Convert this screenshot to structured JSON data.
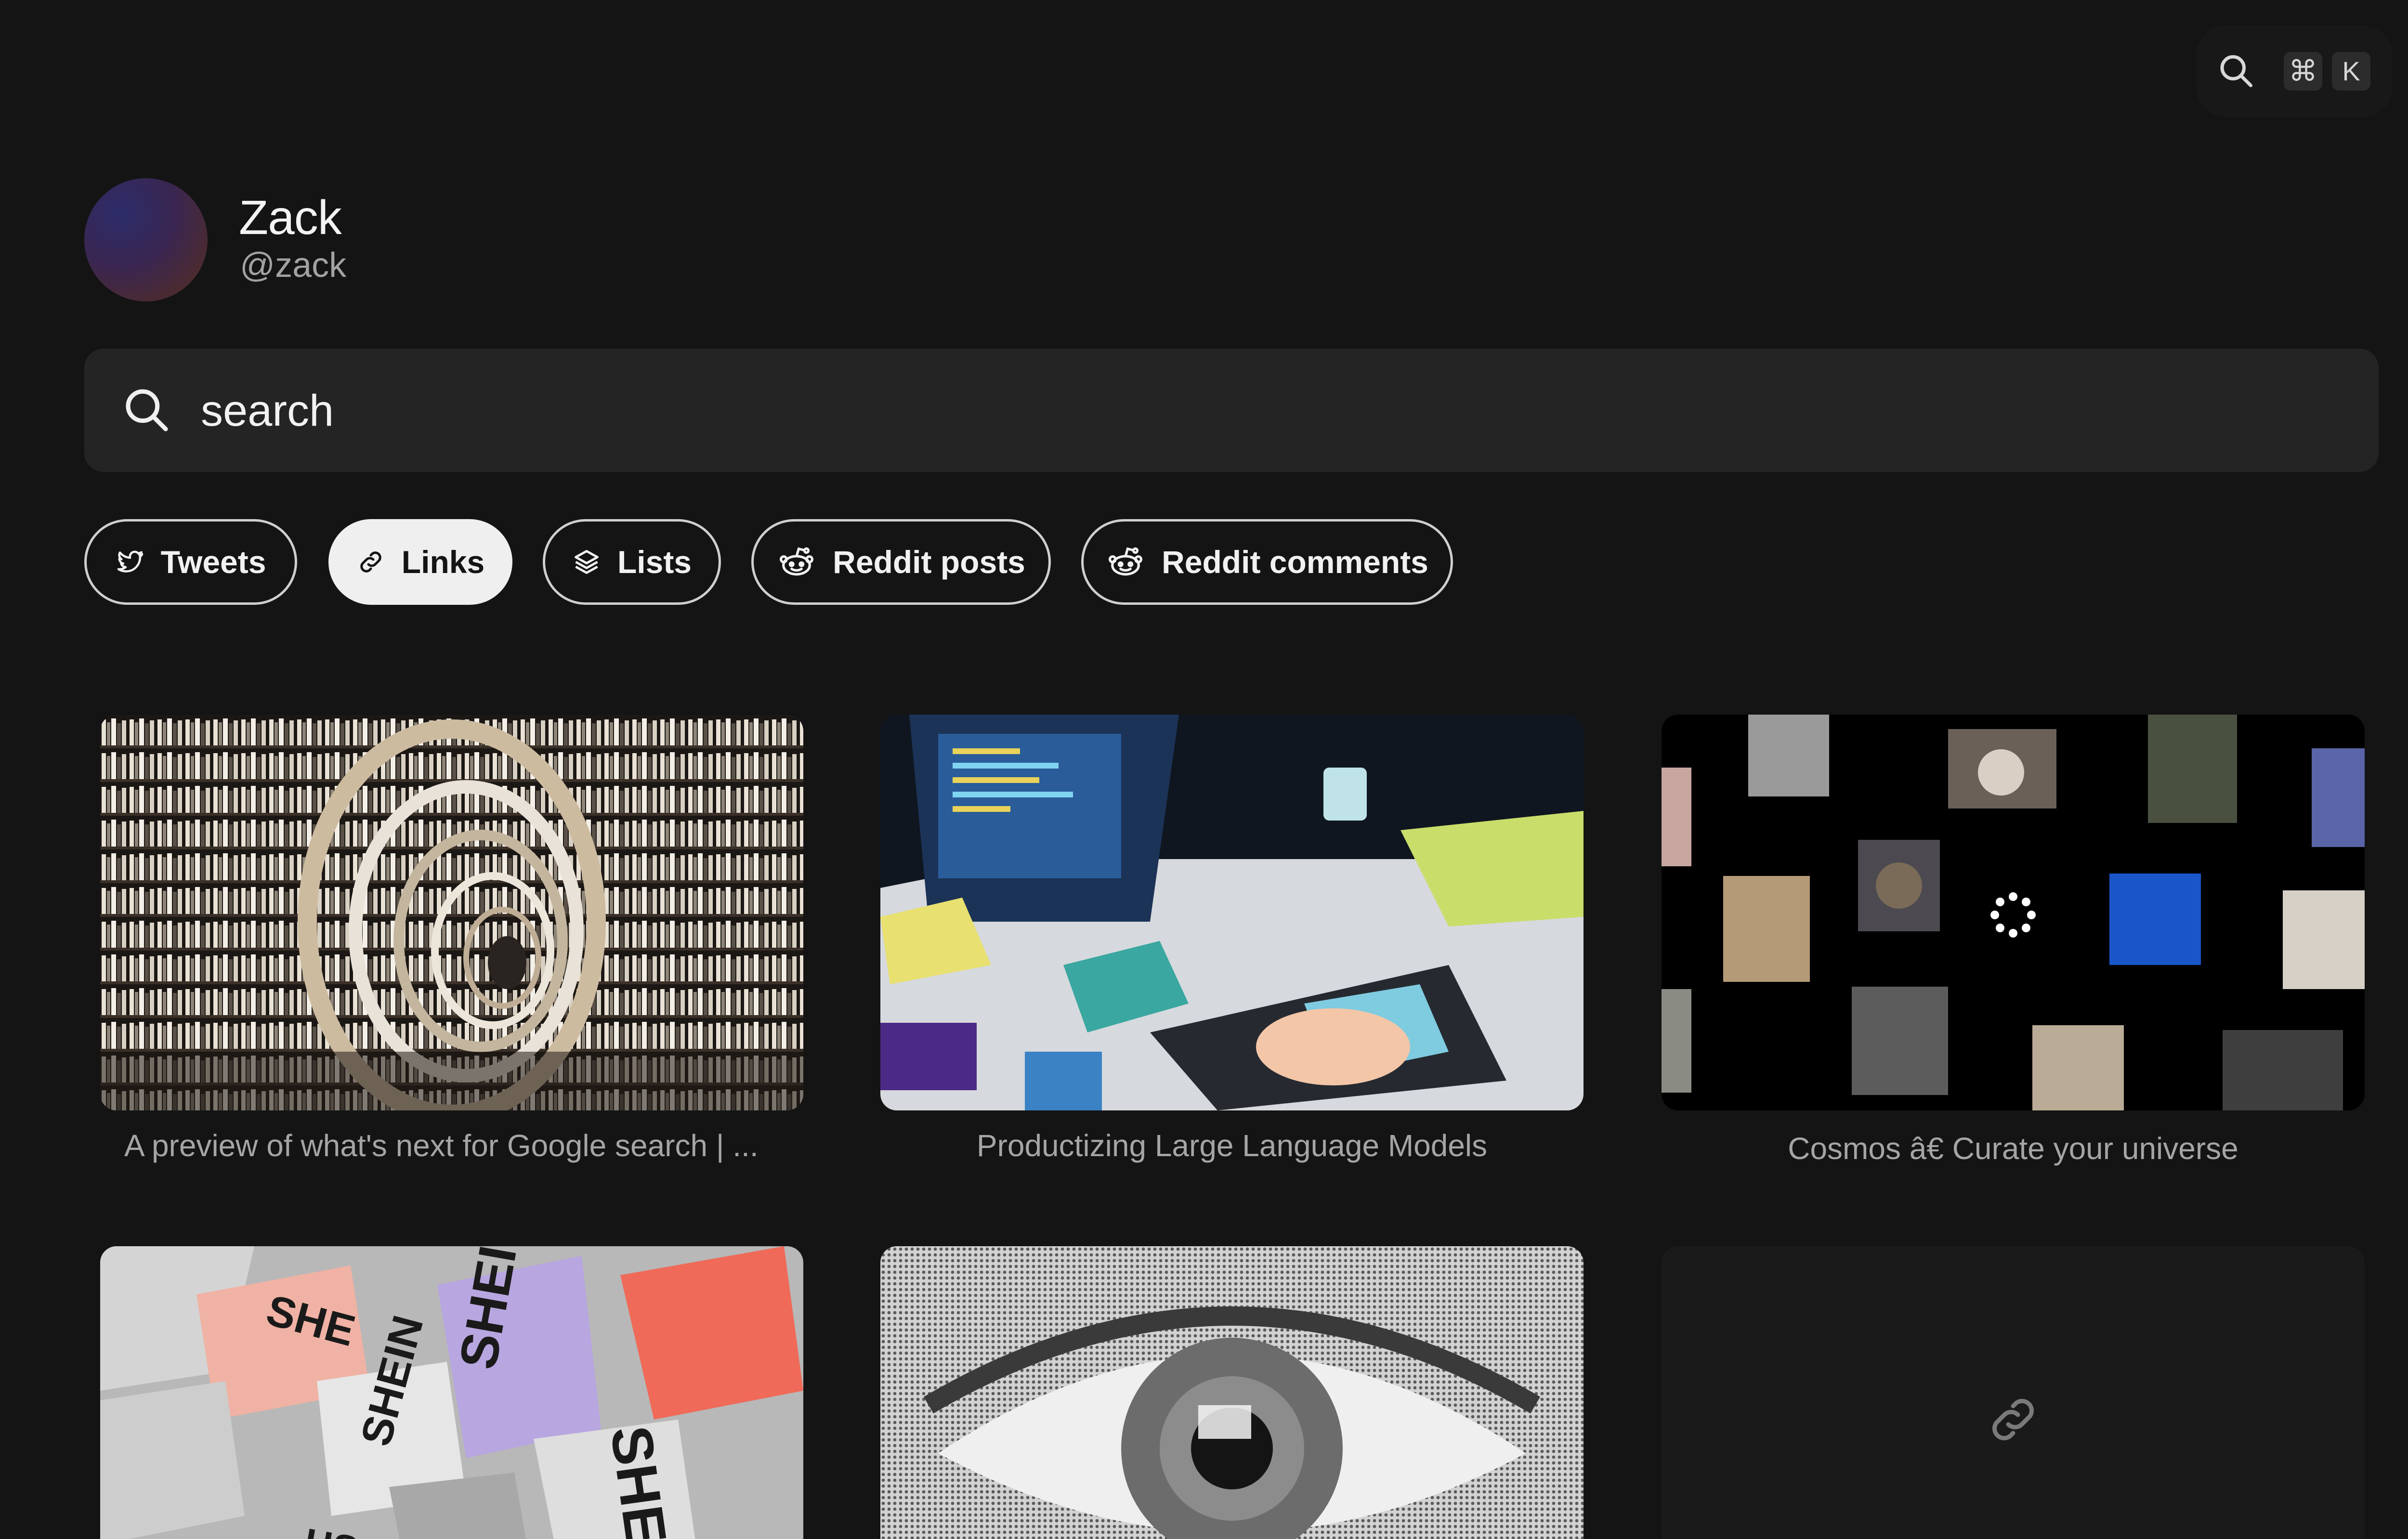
{
  "command_palette": {
    "cmd_key": "⌘",
    "k_key": "K"
  },
  "profile": {
    "display_name": "Zack",
    "handle": "@zack"
  },
  "search": {
    "placeholder": "search",
    "value": ""
  },
  "filters": [
    {
      "label": "Tweets",
      "icon": "twitter-bird-icon",
      "active": false
    },
    {
      "label": "Links",
      "icon": "link-icon",
      "active": true
    },
    {
      "label": "Lists",
      "icon": "layers-icon",
      "active": false
    },
    {
      "label": "Reddit posts",
      "icon": "reddit-icon",
      "active": false
    },
    {
      "label": "Reddit comments",
      "icon": "reddit-icon",
      "active": false
    }
  ],
  "cards": [
    {
      "caption": "A preview of what's next for Google search | ...",
      "thumbnail": "library-tunnel-image"
    },
    {
      "caption": "Productizing Large Language Models",
      "thumbnail": "desk-keyboard-illustration"
    },
    {
      "caption": "Cosmos â€   Curate your universe",
      "thumbnail": "cosmos-collage-image"
    },
    {
      "caption": "",
      "thumbnail": "shein-packages-image"
    },
    {
      "caption": "",
      "thumbnail": "halftone-eye-image"
    },
    {
      "caption": "",
      "thumbnail": "link-placeholder-icon"
    }
  ],
  "colors": {
    "background": "#141414",
    "surface": "#242424",
    "chip_border": "#cfcfcf",
    "chip_active_bg": "#efefef",
    "caption_text": "#a5a5a5"
  }
}
